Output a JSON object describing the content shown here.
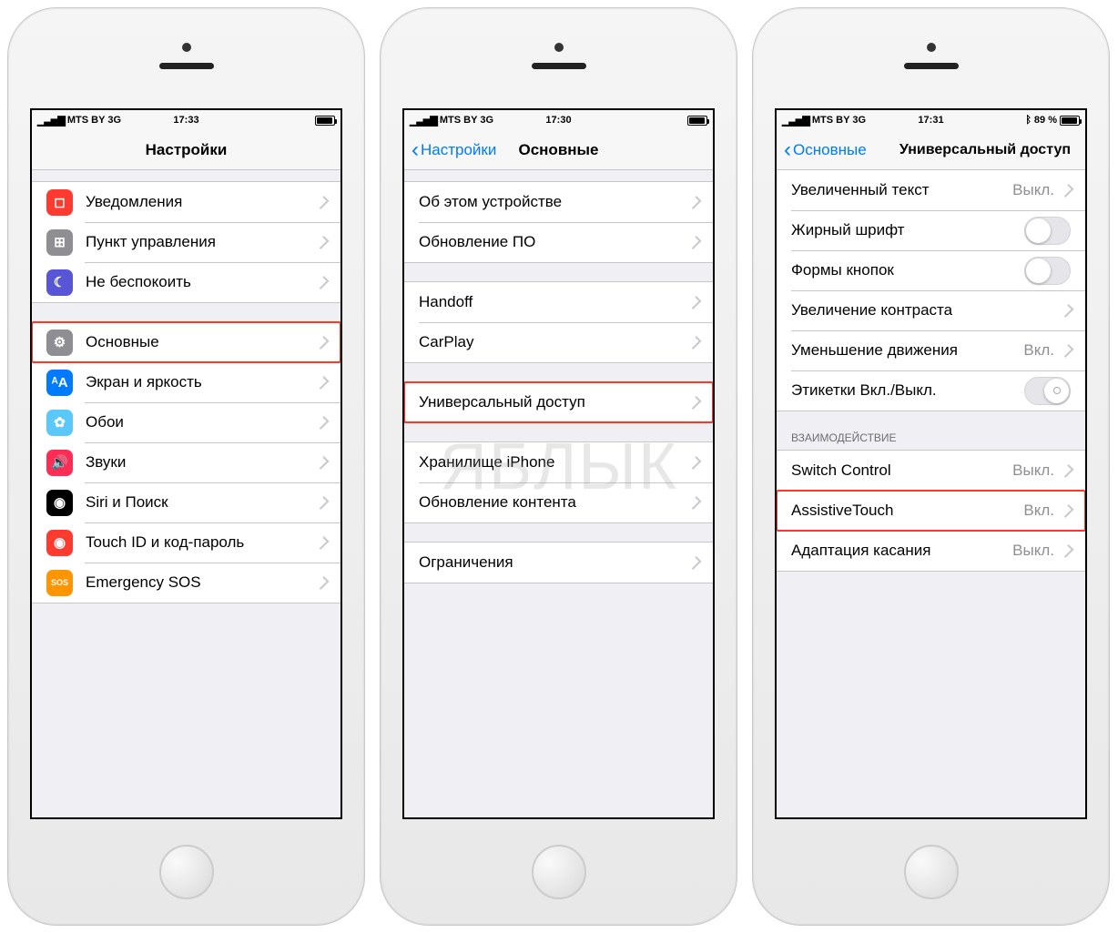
{
  "watermark": "ЯБЛЫК",
  "status": {
    "carrier": "MTS BY",
    "net": "3G",
    "battery_pct": "89 %"
  },
  "values": {
    "off": "Выкл.",
    "on": "Вкл."
  },
  "phone1": {
    "time": "17:33",
    "title": "Настройки",
    "rows_g1": [
      {
        "icon": "notifications-icon",
        "cls": "ic-red",
        "glyph": "◻",
        "label": "Уведомления"
      },
      {
        "icon": "control-center-icon",
        "cls": "ic-gray",
        "glyph": "⊞",
        "label": "Пункт управления"
      },
      {
        "icon": "dnd-icon",
        "cls": "ic-purple",
        "glyph": "☾",
        "label": "Не беспокоить"
      }
    ],
    "rows_g2": [
      {
        "icon": "general-icon",
        "cls": "ic-gray",
        "glyph": "⚙",
        "label": "Основные",
        "hl": true
      },
      {
        "icon": "display-icon",
        "cls": "ic-blue",
        "glyph": "ᴬA",
        "label": "Экран и яркость"
      },
      {
        "icon": "wallpaper-icon",
        "cls": "ic-teal",
        "glyph": "✿",
        "label": "Обои"
      },
      {
        "icon": "sounds-icon",
        "cls": "ic-pink",
        "glyph": "🔊",
        "label": "Звуки"
      },
      {
        "icon": "siri-icon",
        "cls": "ic-black",
        "glyph": "◉",
        "label": "Siri и Поиск"
      },
      {
        "icon": "touchid-icon",
        "cls": "ic-red",
        "glyph": "◉",
        "label": "Touch ID и код-пароль"
      },
      {
        "icon": "sos-icon",
        "cls": "ic-orange",
        "glyph": "SOS",
        "label": "Emergency SOS"
      }
    ]
  },
  "phone2": {
    "time": "17:30",
    "back": "Настройки",
    "title": "Основные",
    "g1": [
      {
        "label": "Об этом устройстве"
      },
      {
        "label": "Обновление ПО"
      }
    ],
    "g2": [
      {
        "label": "Handoff"
      },
      {
        "label": "CarPlay"
      }
    ],
    "g3": [
      {
        "label": "Универсальный доступ",
        "hl": true
      }
    ],
    "g4": [
      {
        "label": "Хранилище iPhone"
      },
      {
        "label": "Обновление контента"
      }
    ],
    "g5": [
      {
        "label": "Ограничения"
      }
    ]
  },
  "phone3": {
    "time": "17:31",
    "back": "Основные",
    "title": "Универсальный доступ",
    "g1": [
      {
        "label": "Увеличенный текст",
        "value": "Выкл.",
        "accessory": "chevron"
      },
      {
        "label": "Жирный шрифт",
        "accessory": "toggle"
      },
      {
        "label": "Формы кнопок",
        "accessory": "toggle"
      },
      {
        "label": "Увеличение контраста",
        "accessory": "chevron"
      },
      {
        "label": "Уменьшение движения",
        "value": "Вкл.",
        "accessory": "chevron"
      },
      {
        "label": "Этикетки Вкл./Выкл.",
        "accessory": "toggle-special"
      }
    ],
    "g2_header": "ВЗАИМОДЕЙСТВИЕ",
    "g2": [
      {
        "label": "Switch Control",
        "value": "Выкл.",
        "accessory": "chevron"
      },
      {
        "label": "AssistiveTouch",
        "value": "Вкл.",
        "accessory": "chevron",
        "hl": true
      },
      {
        "label": "Адаптация касания",
        "value": "Выкл.",
        "accessory": "chevron"
      }
    ]
  }
}
